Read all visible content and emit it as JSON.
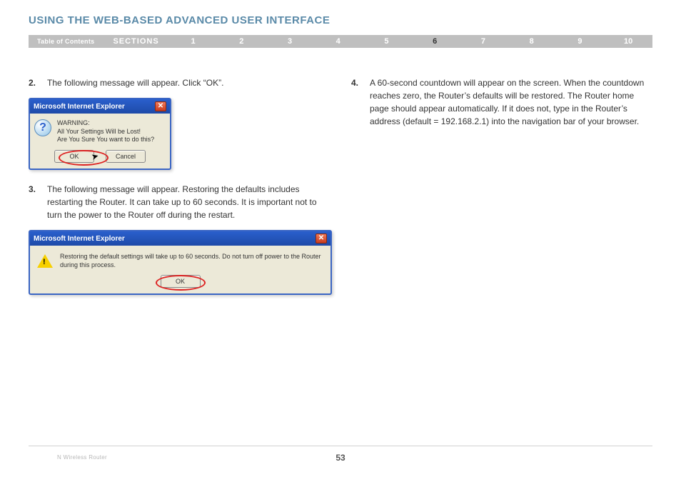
{
  "heading": "USING THE WEB-BASED ADVANCED USER INTERFACE",
  "nav": {
    "toc": "Table of Contents",
    "sections": "SECTIONS",
    "items": [
      "1",
      "2",
      "3",
      "4",
      "5",
      "6",
      "7",
      "8",
      "9",
      "10"
    ],
    "currentIndex": 5
  },
  "left": {
    "step2": {
      "num": "2.",
      "text": "The following message will appear. Click “OK”."
    },
    "dialog1": {
      "title": "Microsoft Internet Explorer",
      "body_line1": "WARNING:",
      "body_line2": "All Your Settings Will be Lost!",
      "body_line3": "Are You Sure You want to do this?",
      "ok": "OK",
      "cancel": "Cancel"
    },
    "step3": {
      "num": "3.",
      "text": "The following message will appear. Restoring the defaults includes restarting the Router. It can take up to 60 seconds. It is important not to turn the power to the Router off during the restart."
    },
    "dialog2": {
      "title": "Microsoft Internet Explorer",
      "body": "Restoring the default settings will take up to 60 seconds. Do not turn off power to the Router during this process.",
      "ok": "OK"
    }
  },
  "right": {
    "step4": {
      "num": "4.",
      "text": "A 60-second countdown will appear on the screen. When the countdown reaches zero, the Router’s defaults will be restored. The Router home page should appear automatically. If it does not, type in the Router’s address (default = 192.168.2.1) into the navigation bar of your browser."
    }
  },
  "footer": {
    "product": "N Wireless Router",
    "page": "53"
  }
}
